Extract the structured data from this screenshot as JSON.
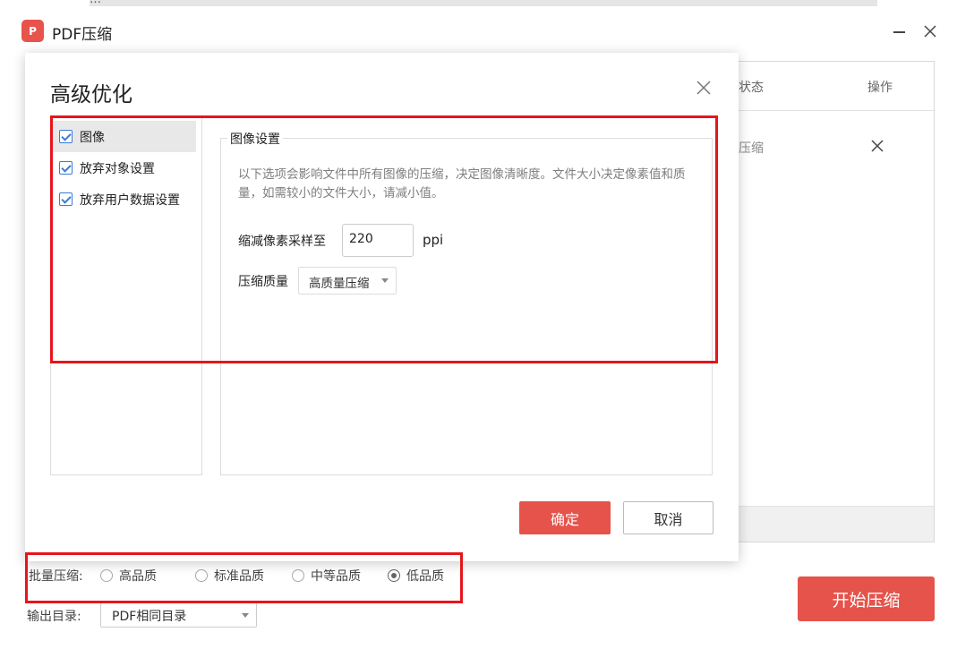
{
  "window": {
    "title": "PDF压缩",
    "logo_glyph": "P",
    "brand_color": "#e5534b",
    "top_strip_text": "…"
  },
  "background": {
    "table": {
      "col_status": "状态",
      "col_operation": "操作"
    },
    "row": {
      "status": "压缩"
    },
    "batch": {
      "label": "批量压缩:",
      "options": [
        {
          "label": "高品质",
          "checked": false
        },
        {
          "label": "标准品质",
          "checked": false
        },
        {
          "label": "中等品质",
          "checked": false
        },
        {
          "label": "低品质",
          "checked": true
        }
      ]
    },
    "output": {
      "label": "输出目录:",
      "value": "PDF相同目录"
    },
    "start_button": "开始压缩"
  },
  "dialog": {
    "title": "高级优化",
    "categories": [
      {
        "label": "图像",
        "checked": true,
        "selected": true
      },
      {
        "label": "放弃对象设置",
        "checked": true,
        "selected": false
      },
      {
        "label": "放弃用户数据设置",
        "checked": true,
        "selected": false
      }
    ],
    "image_settings": {
      "group_title": "图像设置",
      "description": "以下选项会影响文件中所有图像的压缩，决定图像清晰度。文件大小决定像素值和质量，如需较小的文件大小，请减小值。",
      "downsample_label": "缩减像素采样至",
      "downsample_value": "220",
      "downsample_unit": "ppi",
      "quality_label": "压缩质量",
      "quality_value": "高质量压缩"
    },
    "ok_button": "确定",
    "cancel_button": "取消"
  },
  "annotation_color": "#e5161b"
}
